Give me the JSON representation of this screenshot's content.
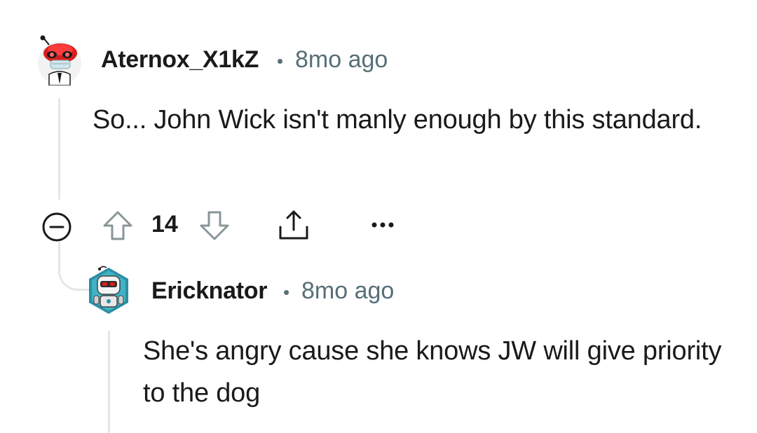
{
  "comments": [
    {
      "username": "Aternox_X1kZ",
      "separator": "•",
      "time": "8mo ago",
      "body": "So... John Wick isn't manly enough by this standard.",
      "avatar": "snoo-avatar-red-helmet-icon",
      "actions": {
        "score": "14",
        "collapse_icon": "minus-circle-icon",
        "upvote_icon": "arrow-up-icon",
        "downvote_icon": "arrow-down-icon",
        "share_icon": "share-icon",
        "more_icon": "ellipsis-icon"
      }
    },
    {
      "username": "Ericknator",
      "separator": "•",
      "time": "8mo ago",
      "body": "She's angry cause she knows JW will give priority to the dog",
      "avatar": "snoo-avatar-robot-icon"
    }
  ],
  "colors": {
    "text": "#1a1a1b",
    "meta": "#576f76",
    "thread_line": "#e4e6e8",
    "avatar1_accent": "#d61f1f",
    "avatar2_accent": "#2b8fa3"
  }
}
